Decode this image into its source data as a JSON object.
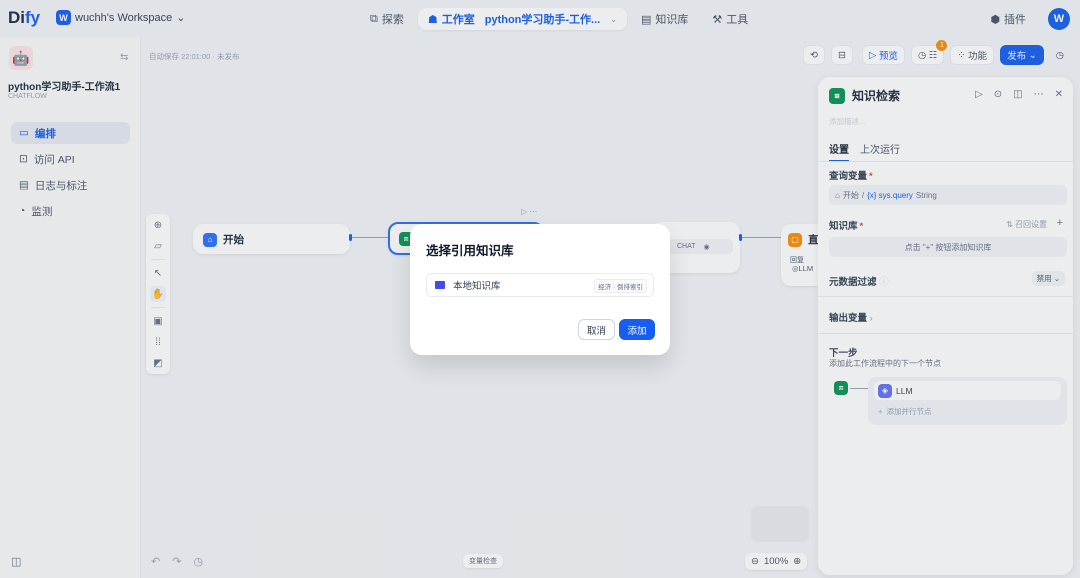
{
  "brand": {
    "name_part1": "Di",
    "name_part2": "fy"
  },
  "workspace": {
    "badge": "W",
    "name": "wuchh's Workspace",
    "chevron": "⌄"
  },
  "nav": {
    "explore": "探索",
    "studio": "工作室",
    "current_app": "python学习助手-工作...",
    "knowledge": "知识库",
    "tools": "工具"
  },
  "user": {
    "plugins": "插件",
    "avatar": "W"
  },
  "app": {
    "name": "python学习助手-工作流1",
    "type": "CHATFLOW"
  },
  "sidebar_menu": [
    {
      "label": "编排"
    },
    {
      "label": "访问 API"
    },
    {
      "label": "日志与标注"
    },
    {
      "label": "监测"
    }
  ],
  "canvas": {
    "autosave": "自动保存 22:01:00 · 未发布",
    "start_node": "开始",
    "chat_tag": "CHAT",
    "llm_node_title": "直",
    "llm_node_sub1": "回复",
    "llm_node_sub2": "LLM",
    "bottom_center": "变量检查",
    "zoom": "100%"
  },
  "canvas_toolbar": {
    "preview": "预览",
    "features": "功能",
    "publish": "发布",
    "notif_count": "1"
  },
  "panel": {
    "title": "知识检索",
    "desc_placeholder": "添加描述...",
    "tabs": [
      "设置",
      "上次运行"
    ],
    "query_label": "查询变量",
    "query_value_prefix": "开始",
    "query_var": "{x} sys.query",
    "query_type": "String",
    "kb_label": "知识库",
    "kb_settings": "召回设置",
    "kb_hint": "点击 \"+\" 按钮添加知识库",
    "meta_label": "元数据过滤",
    "meta_value": "禁用",
    "output_label": "输出变量",
    "next_label": "下一步",
    "next_desc": "添加此工作流程中的下一个节点",
    "next_item": "LLM",
    "next_add": "添加并行节点"
  },
  "modal": {
    "title": "选择引用知识库",
    "item_name": "本地知识库",
    "item_tag": "经济 · 倒排索引",
    "cancel": "取消",
    "confirm": "添加"
  }
}
